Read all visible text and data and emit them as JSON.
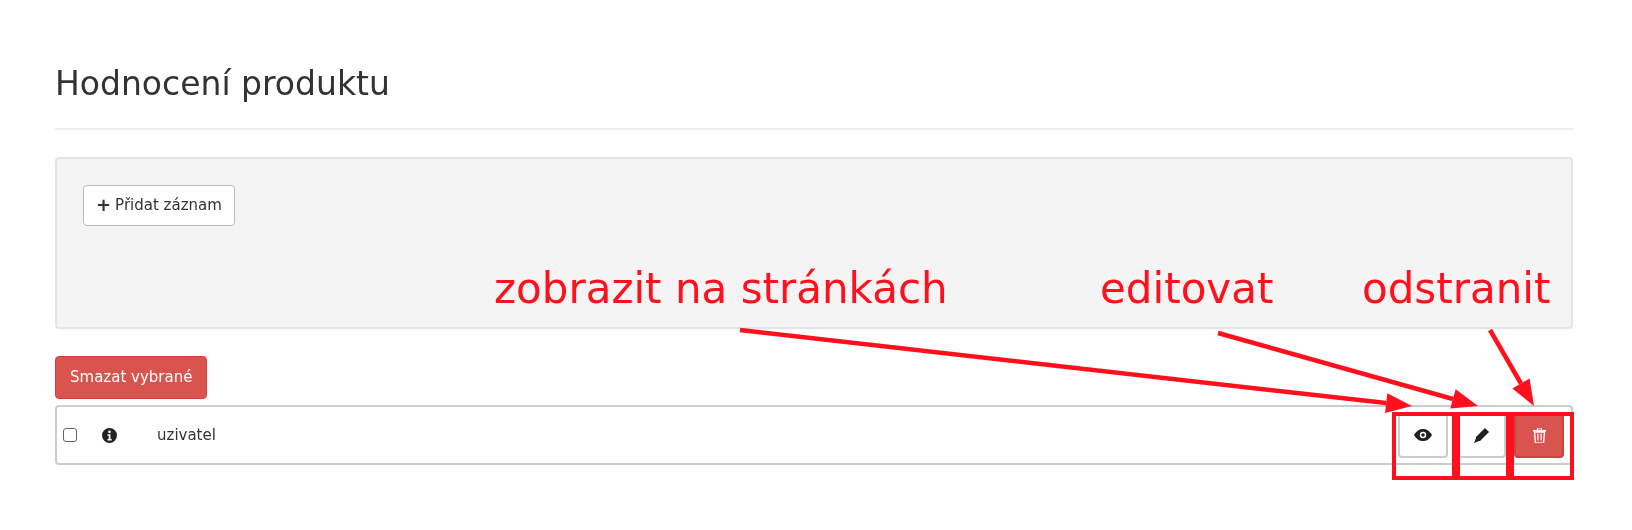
{
  "heading": "Hodnocení produktu",
  "add_button": {
    "icon": "+",
    "label": "Přidat záznam"
  },
  "delete_selected_button": "Smazat vybrané",
  "rows": [
    {
      "checked": false,
      "name": "uzivatel",
      "actions": [
        {
          "kind": "view"
        },
        {
          "kind": "edit"
        },
        {
          "kind": "delete"
        }
      ]
    }
  ],
  "annotations": [
    {
      "label": "zobrazit na stránkách"
    },
    {
      "label": "editovat"
    },
    {
      "label": "odstranit"
    }
  ]
}
